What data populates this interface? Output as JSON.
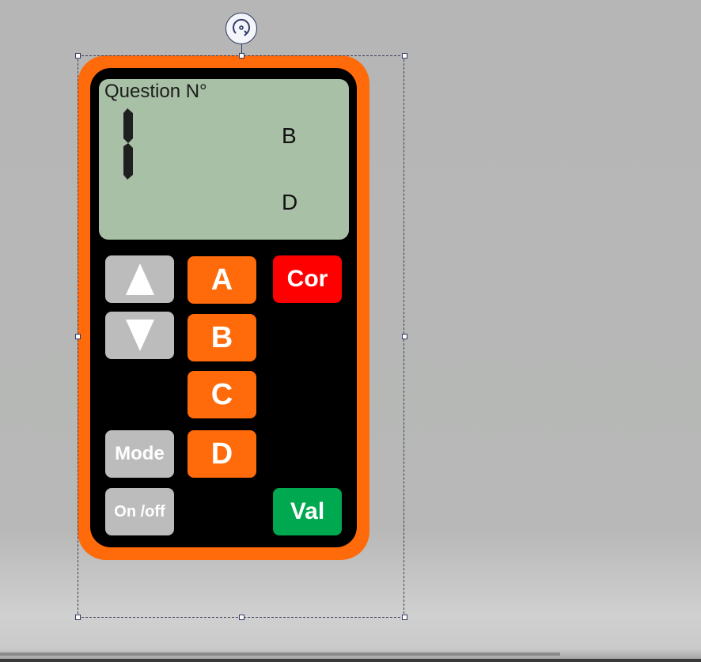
{
  "device": {
    "screen": {
      "title": "Question N°",
      "question_number": "1",
      "answer_top": "B",
      "answer_bottom": "D"
    },
    "keys": {
      "up_icon": "up-arrow",
      "down_icon": "down-arrow",
      "a_label": "A",
      "b_label": "B",
      "c_label": "C",
      "d_label": "D",
      "cor_label": "Cor",
      "mode_label": "Mode",
      "onoff_label": "On /off",
      "val_label": "Val"
    },
    "colors": {
      "body": "#ff6a0a",
      "screen": "#a8c0a6",
      "key_grey": "#bcbcbc",
      "key_orange": "#ff6a0a",
      "key_cor": "#ff0000",
      "key_val": "#00a84f"
    }
  },
  "selection": {
    "rotate_icon": "rotate-icon"
  }
}
